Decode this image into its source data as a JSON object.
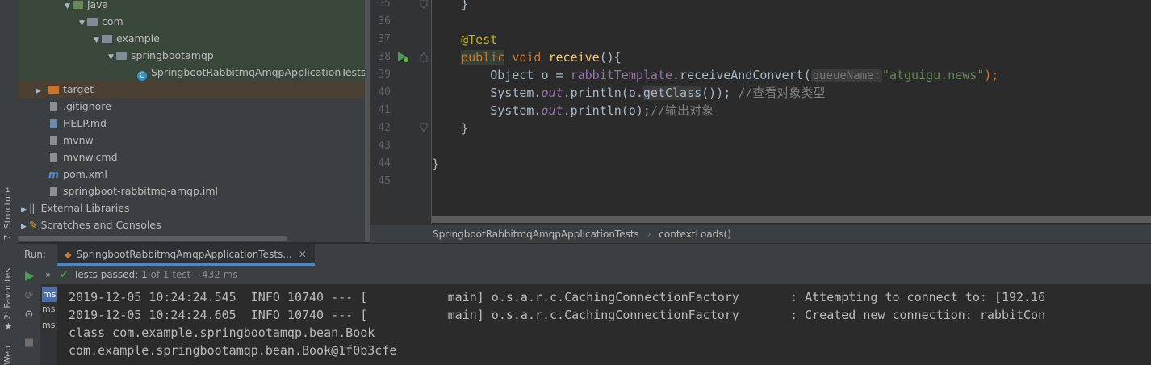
{
  "tool_windows": {
    "structure": "7: Structure",
    "favorites": "2: Favorites",
    "web": "Web"
  },
  "tree": [
    {
      "label": "java",
      "icon": "folder-green-icon",
      "expanded": true
    },
    {
      "label": "com",
      "icon": "package-icon",
      "expanded": true
    },
    {
      "label": "example",
      "icon": "package-icon",
      "expanded": true
    },
    {
      "label": "springbootamqp",
      "icon": "package-icon",
      "expanded": true
    },
    {
      "label": "SpringbootRabbitmqAmqpApplicationTests",
      "icon": "test-class-icon"
    },
    {
      "label": "target",
      "icon": "folder-orange-icon",
      "expanded": false
    },
    {
      "label": ".gitignore",
      "icon": "file-icon"
    },
    {
      "label": "HELP.md",
      "icon": "markdown-icon"
    },
    {
      "label": "mvnw",
      "icon": "file-icon"
    },
    {
      "label": "mvnw.cmd",
      "icon": "file-icon"
    },
    {
      "label": "pom.xml",
      "icon": "maven-icon"
    },
    {
      "label": "springboot-rabbitmq-amqp.iml",
      "icon": "iml-file-icon"
    },
    {
      "label": "External Libraries",
      "icon": "libraries-icon",
      "expanded": false
    },
    {
      "label": "Scratches and Consoles",
      "icon": "scratches-icon",
      "expanded": false
    }
  ],
  "editor": {
    "line_numbers": [
      "35",
      "36",
      "37",
      "38",
      "39",
      "40",
      "41",
      "42",
      "43",
      "44",
      "45"
    ],
    "code": {
      "l35_brace": "    }",
      "l37_annotation": "@Test",
      "l38_public": "public",
      "l38_void": " void ",
      "l38_method": "receive",
      "l38_rest": "(){",
      "l39_a": "        Object o = ",
      "l39_field": "rabbitTemplate",
      "l39_b": ".receiveAndConvert(",
      "l39_hint": "queueName:",
      "l39_string": "\"atguigu.news\"",
      "l39_end": ");",
      "l40_a": "        System.",
      "l40_out": "out",
      "l40_b": ".println(o.",
      "l40_getclass": "getClass",
      "l40_c": "()); ",
      "l40_comment": "//查看对象类型",
      "l41_a": "        System.",
      "l41_out": "out",
      "l41_b": ".println(o);",
      "l41_comment": "//输出对象",
      "l42_brace": "    }",
      "l44_brace": "}"
    },
    "breadcrumb": [
      "SpringbootRabbitmqAmqpApplicationTests",
      "contextLoads()"
    ]
  },
  "run": {
    "label": "Run:",
    "tab": "SpringbootRabbitmqAmqpApplicationTests...",
    "status_prefix": "Tests passed: ",
    "passed": "1",
    "status_suffix": " of 1 test – 432 ms",
    "ms_labels": [
      "ms",
      "ms",
      "ms"
    ],
    "console": [
      "2019-12-05 10:24:24.545  INFO 10740 --- [           main] o.s.a.r.c.CachingConnectionFactory       : Attempting to connect to: [192.16",
      "2019-12-05 10:24:24.605  INFO 10740 --- [           main] o.s.a.r.c.CachingConnectionFactory       : Created new connection: rabbitCon",
      "class com.example.springbootamqp.bean.Book",
      "com.example.springbootamqp.bean.Book@1f0b3cfe"
    ]
  }
}
